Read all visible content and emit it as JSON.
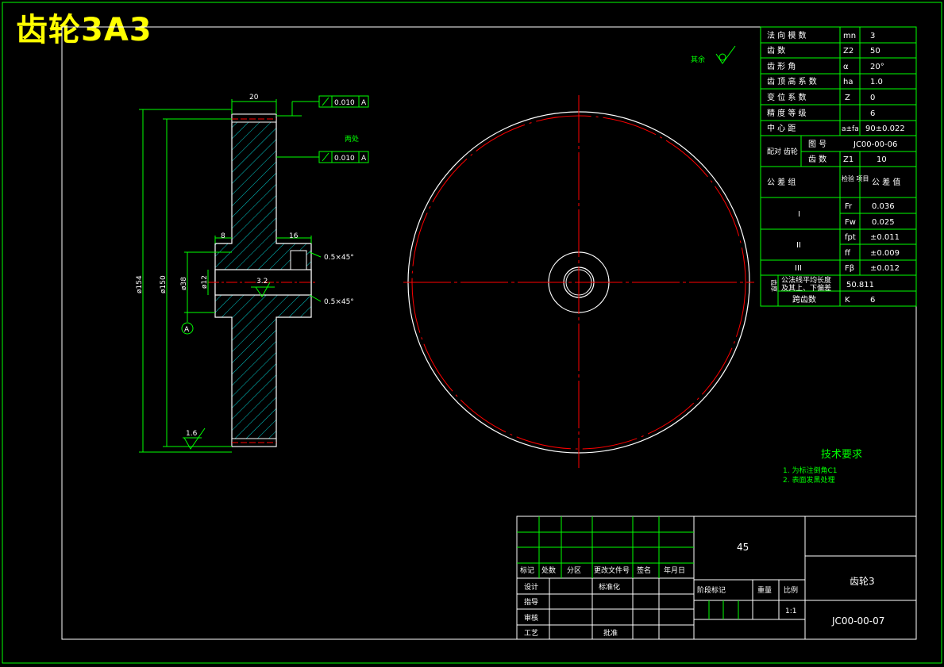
{
  "title": "齿轮3A3",
  "colors": {
    "frame": "#00ff00",
    "text": "#ffffff",
    "center": "#ff0000",
    "hatch": "#00ffff",
    "title": "#ffff00",
    "requirements": "#00ff00"
  },
  "side_view": {
    "dims": {
      "width_top": "20",
      "hub_left": "8",
      "hub_right": "16",
      "dia_outer": "ø154",
      "dia_pitch": "ø150",
      "dia_hub": "ø38",
      "dia_bore": "ø12"
    },
    "tolerance_top": "0.010",
    "tolerance_mid": "0.010",
    "datum": "A",
    "chamfer_top": "0.5×45°",
    "chamfer_bottom": "0.5×45°",
    "roughness_bore": "3.2",
    "roughness_face": "1.6",
    "note_both_sides": "两处",
    "note_rest": "其余"
  },
  "param_table": [
    {
      "label": "法 向 模 数",
      "sym": "mn",
      "val": "3"
    },
    {
      "label": "齿 数",
      "sym": "Z2",
      "val": "50"
    },
    {
      "label": "齿 形 角",
      "sym": "α",
      "val": "20°"
    },
    {
      "label": "齿 顶 高 系 数",
      "sym": "ha",
      "val": "1.0"
    },
    {
      "label": "变 位 系 数",
      "sym": "Z",
      "val": "0"
    },
    {
      "label": "精 度 等 级",
      "sym": "",
      "val": "6"
    },
    {
      "label": "中 心 距",
      "sym": "a±fa",
      "val": "90±0.022"
    }
  ],
  "mating": {
    "label": "配对 齿轮",
    "drawing_no_label": "图 号",
    "drawing_no": "JC00-00-06",
    "teeth_label": "齿 数",
    "teeth_sym": "Z1",
    "teeth": "10"
  },
  "tolerance_group": {
    "header_group": "公 差 组",
    "header_item": "检验 项目",
    "header_value": "公 差 值",
    "rows": [
      {
        "group": "I",
        "items": [
          {
            "sym": "Fr",
            "val": "0.036"
          },
          {
            "sym": "Fw",
            "val": "0.025"
          }
        ]
      },
      {
        "group": "II",
        "items": [
          {
            "sym": "fpt",
            "val": "±0.011"
          },
          {
            "sym": "ff",
            "val": "±0.009"
          }
        ]
      },
      {
        "group": "III",
        "items": [
          {
            "sym": "Fβ",
            "val": "±0.012"
          }
        ]
      }
    ]
  },
  "tooth_thickness": {
    "label": "齿厚",
    "line1": "公法线平均长度",
    "line2": "及其上、下偏差",
    "val": "50.811",
    "count_label": "跨齿数",
    "count_sym": "K",
    "count": "6"
  },
  "requirements": {
    "title": "技术要求",
    "items": [
      "1. 为标注倒角C1",
      "2. 表面发黑处理"
    ]
  },
  "title_block": {
    "material": "45",
    "part_name": "齿轮3",
    "drawing_no": "JC00-00-07",
    "headers": [
      "标记",
      "处数",
      "分区",
      "更改文件号",
      "签名",
      "年月日"
    ],
    "rows": [
      "设计",
      "指导",
      "审核",
      "工艺"
    ],
    "standardize": "标准化",
    "approve": "批准",
    "stage": "阶段标记",
    "weight": "重量",
    "scale_label": "比例",
    "scale": "1:1"
  }
}
